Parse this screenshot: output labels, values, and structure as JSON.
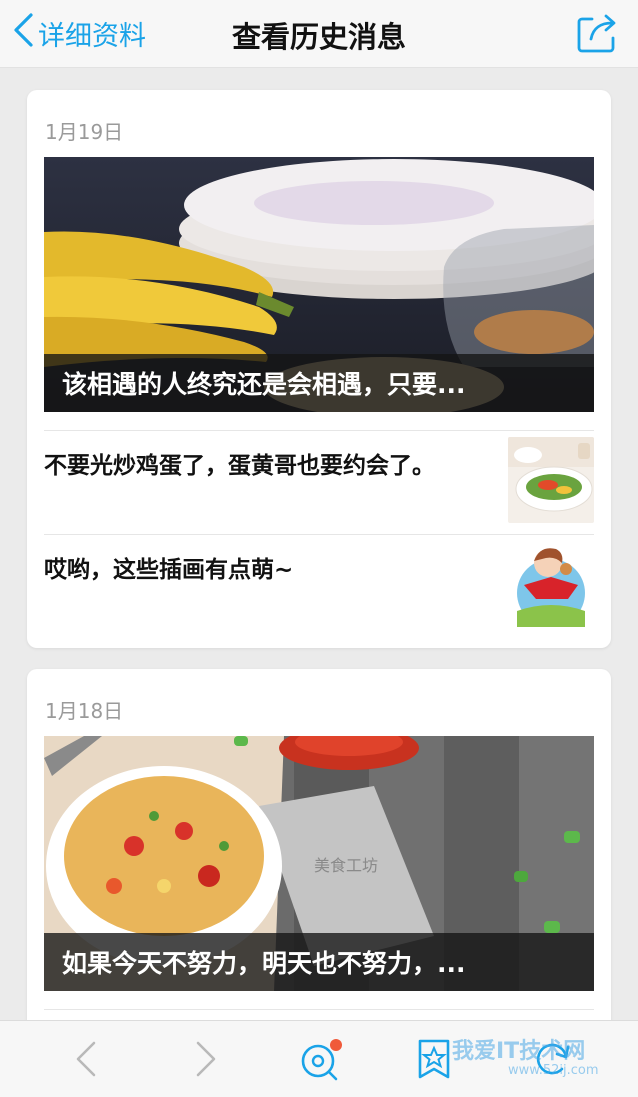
{
  "navbar": {
    "back_label": "详细资料",
    "title": "查看历史消息",
    "back_icon": "chevron-left-icon",
    "share_icon": "share-icon"
  },
  "cards": [
    {
      "date": "1月19日",
      "hero_caption": "该相遇的人终究还是会相遇，只要...",
      "rows": [
        {
          "title": "不要光炒鸡蛋了，蛋黄哥也要约会了。",
          "thumb": "stir-fry-dish-thumbnail"
        },
        {
          "title": "哎哟，这些插画有点萌~",
          "thumb": "cartoon-girl-illustration-thumbnail"
        }
      ]
    },
    {
      "date": "1月18日",
      "hero_caption": "如果今天不努力，明天也不努力，..."
    }
  ],
  "toolbar": {
    "items": [
      "back-arrow-icon",
      "forward-arrow-icon",
      "discover-icon",
      "bookmark-star-icon",
      "refresh-icon"
    ],
    "badge_color": "#f05a3a"
  },
  "watermark": {
    "text": "我爱IT技术网",
    "subtext": "www.52ij.com"
  },
  "colors": {
    "accent": "#1aa3e8",
    "background": "#ebebeb"
  }
}
